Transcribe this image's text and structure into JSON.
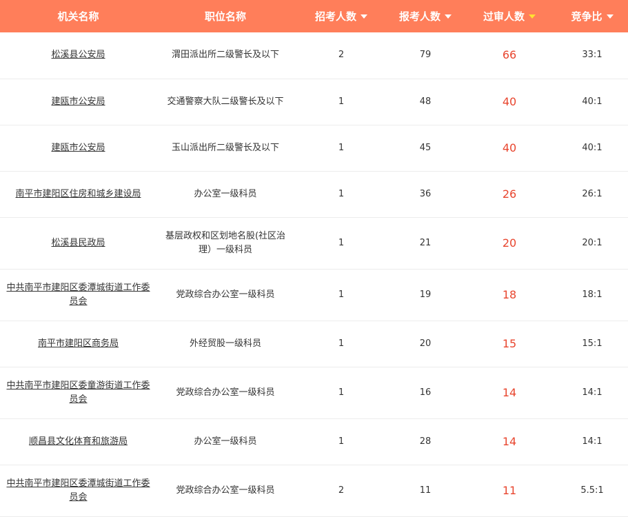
{
  "header": {
    "agency": "机关名称",
    "position": "职位名称",
    "recruit": "招考人数",
    "apply": "报考人数",
    "passed": "过审人数",
    "ratio": "竞争比"
  },
  "colors": {
    "header_bg": "#ff7e5a",
    "header_text": "#ffffff",
    "active_sort_caret": "#ffe033",
    "passed_value": "#e8452e"
  },
  "rows": [
    {
      "agency": "松溪县公安局",
      "position": "渭田派出所二级警长及以下",
      "recruit": "2",
      "apply": "79",
      "passed": "66",
      "ratio": "33:1"
    },
    {
      "agency": "建瓯市公安局",
      "position": "交通警察大队二级警长及以下",
      "recruit": "1",
      "apply": "48",
      "passed": "40",
      "ratio": "40:1"
    },
    {
      "agency": "建瓯市公安局",
      "position": "玉山派出所二级警长及以下",
      "recruit": "1",
      "apply": "45",
      "passed": "40",
      "ratio": "40:1"
    },
    {
      "agency": "南平市建阳区住房和城乡建设局",
      "position": "办公室一级科员",
      "recruit": "1",
      "apply": "36",
      "passed": "26",
      "ratio": "26:1"
    },
    {
      "agency": "松溪县民政局",
      "position": "基层政权和区划地名股(社区治理）一级科员",
      "recruit": "1",
      "apply": "21",
      "passed": "20",
      "ratio": "20:1"
    },
    {
      "agency": "中共南平市建阳区委潭城街道工作委员会",
      "position": "党政综合办公室一级科员",
      "recruit": "1",
      "apply": "19",
      "passed": "18",
      "ratio": "18:1"
    },
    {
      "agency": "南平市建阳区商务局",
      "position": "外经贸股一级科员",
      "recruit": "1",
      "apply": "20",
      "passed": "15",
      "ratio": "15:1"
    },
    {
      "agency": "中共南平市建阳区委童游街道工作委员会",
      "position": "党政综合办公室一级科员",
      "recruit": "1",
      "apply": "16",
      "passed": "14",
      "ratio": "14:1"
    },
    {
      "agency": "顺昌县文化体育和旅游局",
      "position": "办公室一级科员",
      "recruit": "1",
      "apply": "28",
      "passed": "14",
      "ratio": "14:1"
    },
    {
      "agency": "中共南平市建阳区委潭城街道工作委员会",
      "position": "党政综合办公室一级科员",
      "recruit": "2",
      "apply": "11",
      "passed": "11",
      "ratio": "5.5:1"
    }
  ]
}
